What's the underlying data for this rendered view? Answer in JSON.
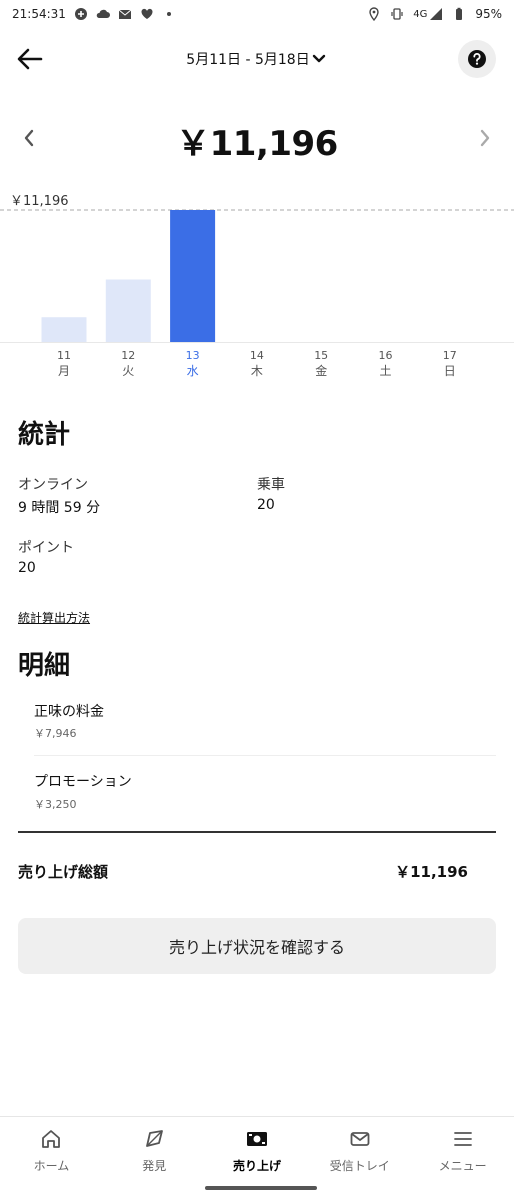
{
  "status_bar": {
    "time": "21:54:31",
    "network": "4G",
    "battery": "95%",
    "icons_left": [
      "add-chat-icon",
      "cloud-icon",
      "mail-icon",
      "heart-icon",
      "dot-icon"
    ],
    "icons_right": [
      "location-icon",
      "vibrate-icon",
      "signal-icon",
      "battery-icon"
    ]
  },
  "header": {
    "date_range": "5月11日 - 5月18日"
  },
  "earnings": {
    "total": "￥11,196"
  },
  "chart_data": {
    "type": "bar",
    "categories": [
      "11",
      "12",
      "13",
      "14",
      "15",
      "16",
      "17"
    ],
    "weekdays": [
      "月",
      "火",
      "水",
      "木",
      "金",
      "土",
      "日"
    ],
    "values": [
      2100,
      5300,
      11196,
      0,
      0,
      0,
      0
    ],
    "selected_index": 2,
    "max_label": "￥11,196",
    "ylim": [
      0,
      11196
    ],
    "colors": {
      "selected": "#3b6ee6",
      "normal": "#dfe7f9",
      "selected_label": "#3b6ee6"
    }
  },
  "stats": {
    "title": "統計",
    "online_label": "オンライン",
    "online_value": "9 時間 59 分",
    "rides_label": "乗車",
    "rides_value": "20",
    "points_label": "ポイント",
    "points_value": "20",
    "method_link": "統計算出方法"
  },
  "breakdown": {
    "title": "明細",
    "items": [
      {
        "label": "正味の料金",
        "value": "￥7,946"
      },
      {
        "label": "プロモーション",
        "value": "￥3,250"
      }
    ],
    "total_label": "売り上げ総額",
    "total_value": "￥11,196"
  },
  "cta": {
    "label": "売り上げ状況を確認する"
  },
  "nav": {
    "items": [
      {
        "label": "ホーム",
        "icon": "home-icon"
      },
      {
        "label": "発見",
        "icon": "compass-icon"
      },
      {
        "label": "売り上げ",
        "icon": "earnings-icon"
      },
      {
        "label": "受信トレイ",
        "icon": "inbox-icon"
      },
      {
        "label": "メニュー",
        "icon": "menu-icon"
      }
    ],
    "active_index": 2
  }
}
